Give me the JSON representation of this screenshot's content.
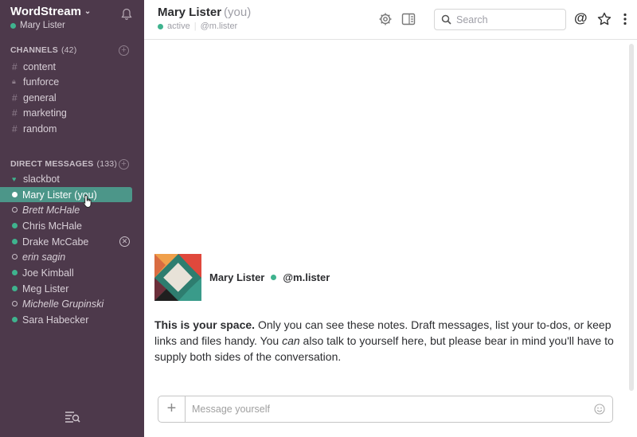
{
  "sidebar": {
    "team_name": "WordStream",
    "current_user": "Mary Lister",
    "channels_heading": "CHANNELS",
    "channels_count": "(42)",
    "channels": [
      {
        "label": "content",
        "prefix": "#"
      },
      {
        "label": "funforce",
        "prefix": "lock"
      },
      {
        "label": "general",
        "prefix": "#"
      },
      {
        "label": "marketing",
        "prefix": "#"
      },
      {
        "label": "random",
        "prefix": "#"
      }
    ],
    "dm_heading": "DIRECT MESSAGES",
    "dm_count": "(133)",
    "dms": [
      {
        "label": "slackbot",
        "status": "heart"
      },
      {
        "label": "Mary Lister (you)",
        "status": "online",
        "active": true
      },
      {
        "label": "Brett McHale",
        "status": "away"
      },
      {
        "label": "Chris McHale",
        "status": "online"
      },
      {
        "label": "Drake McCabe",
        "status": "online"
      },
      {
        "label": "erin sagin",
        "status": "away"
      },
      {
        "label": "Joe Kimball",
        "status": "online"
      },
      {
        "label": "Meg Lister",
        "status": "online"
      },
      {
        "label": "Michelle Grupinski",
        "status": "away"
      },
      {
        "label": "Sara Habecker",
        "status": "online"
      }
    ]
  },
  "header": {
    "title": "Mary Lister",
    "title_suffix": "(you)",
    "presence": "active",
    "handle": "@m.lister",
    "search_placeholder": "Search"
  },
  "intro": {
    "name": "Mary Lister",
    "handle": "@m.lister",
    "bold_lead": "This is your space.",
    "text_1": " Only you can see these notes. Draft messages, list your to-dos, or keep links and files handy. You ",
    "text_emph": "can",
    "text_2": " also talk to yourself here, but please bear in mind you'll have to supply both sides of the conversation."
  },
  "composer": {
    "placeholder": "Message yourself"
  },
  "colors": {
    "sidebar_bg": "#4d394b",
    "active_item": "#4c9689",
    "presence_green": "#3fb38e"
  }
}
